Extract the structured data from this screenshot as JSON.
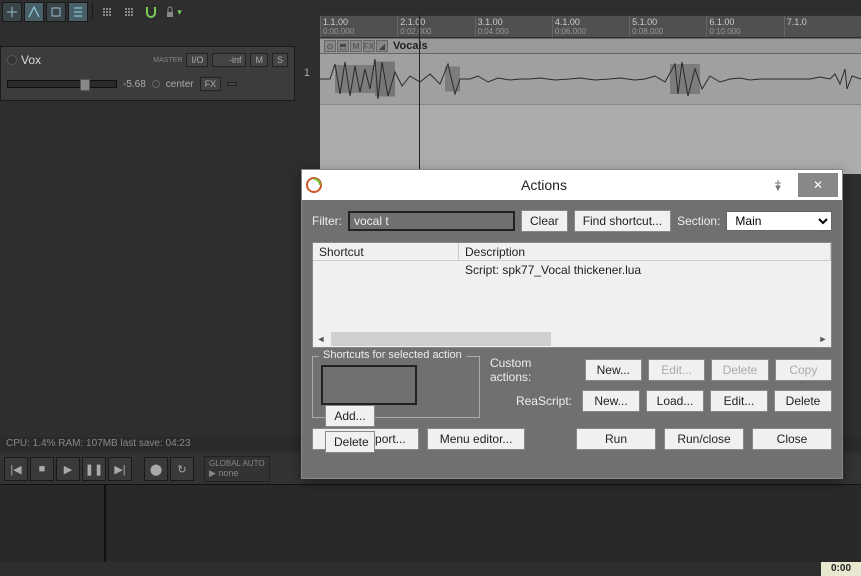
{
  "toolbar": {
    "buttons": [
      "auto-crossfade",
      "ripple-edit",
      "grid-move",
      "snap",
      "lock"
    ]
  },
  "ruler": [
    {
      "bar": "1.1.00",
      "time": "0:00.000"
    },
    {
      "bar": "2.1.00",
      "time": "0:02.000"
    },
    {
      "bar": "3.1.00",
      "time": "0:04.000"
    },
    {
      "bar": "4.1.00",
      "time": "0:06.000"
    },
    {
      "bar": "5.1.00",
      "time": "0:08.000"
    },
    {
      "bar": "6.1.00",
      "time": "0:10.000"
    },
    {
      "bar": "7.1.0",
      "time": ""
    }
  ],
  "track": {
    "name": "Vox",
    "number": "1",
    "master_label": "MASTER",
    "io": "I/O",
    "inf": "-inf",
    "mute": "M",
    "solo": "S",
    "db": "-5.68",
    "center": "center",
    "fx": "FX",
    "arrange_label": "Vocals"
  },
  "status": "CPU: 1.4%  RAM: 107MB   last save: 04:23",
  "automode": {
    "label1": "GLOBAL AUTO",
    "label2": "none"
  },
  "time_display": "0:00",
  "dialog": {
    "title": "Actions",
    "filter_label": "Filter:",
    "filter_value": "vocal t",
    "clear_btn": "Clear",
    "find_btn": "Find shortcut...",
    "section_label": "Section:",
    "section_value": "Main",
    "col_shortcut": "Shortcut",
    "col_desc": "Description",
    "rows": [
      {
        "shortcut": "",
        "desc": "Script: spk77_Vocal thickener.lua"
      }
    ],
    "shortcuts_group": "Shortcuts for selected action",
    "add_btn": "Add...",
    "delete_btn_sc": "Delete",
    "custom_label": "Custom actions:",
    "reascript_label": "ReaScript:",
    "new_btn": "New...",
    "edit_btn": "Edit...",
    "delete_btn": "Delete",
    "copy_btn": "Copy",
    "load_btn": "Load...",
    "import_btn": "Import/export...",
    "menu_btn": "Menu editor...",
    "run_btn": "Run",
    "runclose_btn": "Run/close",
    "close_btn": "Close"
  }
}
